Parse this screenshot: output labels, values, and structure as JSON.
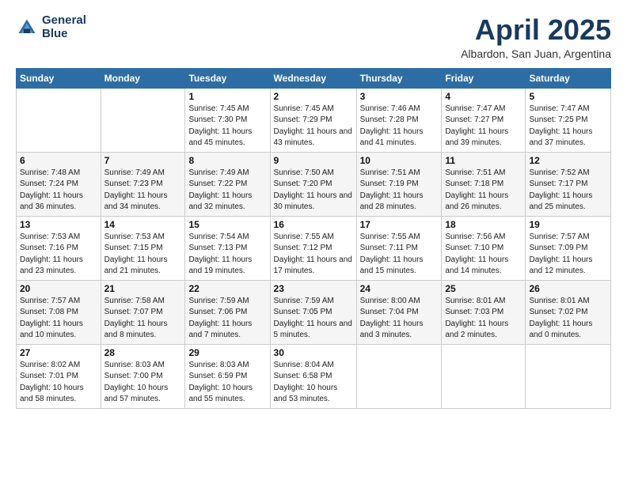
{
  "header": {
    "logo_line1": "General",
    "logo_line2": "Blue",
    "month": "April 2025",
    "location": "Albardon, San Juan, Argentina"
  },
  "days_of_week": [
    "Sunday",
    "Monday",
    "Tuesday",
    "Wednesday",
    "Thursday",
    "Friday",
    "Saturday"
  ],
  "weeks": [
    [
      {
        "day": "",
        "info": ""
      },
      {
        "day": "",
        "info": ""
      },
      {
        "day": "1",
        "info": "Sunrise: 7:45 AM\nSunset: 7:30 PM\nDaylight: 11 hours and 45 minutes."
      },
      {
        "day": "2",
        "info": "Sunrise: 7:45 AM\nSunset: 7:29 PM\nDaylight: 11 hours and 43 minutes."
      },
      {
        "day": "3",
        "info": "Sunrise: 7:46 AM\nSunset: 7:28 PM\nDaylight: 11 hours and 41 minutes."
      },
      {
        "day": "4",
        "info": "Sunrise: 7:47 AM\nSunset: 7:27 PM\nDaylight: 11 hours and 39 minutes."
      },
      {
        "day": "5",
        "info": "Sunrise: 7:47 AM\nSunset: 7:25 PM\nDaylight: 11 hours and 37 minutes."
      }
    ],
    [
      {
        "day": "6",
        "info": "Sunrise: 7:48 AM\nSunset: 7:24 PM\nDaylight: 11 hours and 36 minutes."
      },
      {
        "day": "7",
        "info": "Sunrise: 7:49 AM\nSunset: 7:23 PM\nDaylight: 11 hours and 34 minutes."
      },
      {
        "day": "8",
        "info": "Sunrise: 7:49 AM\nSunset: 7:22 PM\nDaylight: 11 hours and 32 minutes."
      },
      {
        "day": "9",
        "info": "Sunrise: 7:50 AM\nSunset: 7:20 PM\nDaylight: 11 hours and 30 minutes."
      },
      {
        "day": "10",
        "info": "Sunrise: 7:51 AM\nSunset: 7:19 PM\nDaylight: 11 hours and 28 minutes."
      },
      {
        "day": "11",
        "info": "Sunrise: 7:51 AM\nSunset: 7:18 PM\nDaylight: 11 hours and 26 minutes."
      },
      {
        "day": "12",
        "info": "Sunrise: 7:52 AM\nSunset: 7:17 PM\nDaylight: 11 hours and 25 minutes."
      }
    ],
    [
      {
        "day": "13",
        "info": "Sunrise: 7:53 AM\nSunset: 7:16 PM\nDaylight: 11 hours and 23 minutes."
      },
      {
        "day": "14",
        "info": "Sunrise: 7:53 AM\nSunset: 7:15 PM\nDaylight: 11 hours and 21 minutes."
      },
      {
        "day": "15",
        "info": "Sunrise: 7:54 AM\nSunset: 7:13 PM\nDaylight: 11 hours and 19 minutes."
      },
      {
        "day": "16",
        "info": "Sunrise: 7:55 AM\nSunset: 7:12 PM\nDaylight: 11 hours and 17 minutes."
      },
      {
        "day": "17",
        "info": "Sunrise: 7:55 AM\nSunset: 7:11 PM\nDaylight: 11 hours and 15 minutes."
      },
      {
        "day": "18",
        "info": "Sunrise: 7:56 AM\nSunset: 7:10 PM\nDaylight: 11 hours and 14 minutes."
      },
      {
        "day": "19",
        "info": "Sunrise: 7:57 AM\nSunset: 7:09 PM\nDaylight: 11 hours and 12 minutes."
      }
    ],
    [
      {
        "day": "20",
        "info": "Sunrise: 7:57 AM\nSunset: 7:08 PM\nDaylight: 11 hours and 10 minutes."
      },
      {
        "day": "21",
        "info": "Sunrise: 7:58 AM\nSunset: 7:07 PM\nDaylight: 11 hours and 8 minutes."
      },
      {
        "day": "22",
        "info": "Sunrise: 7:59 AM\nSunset: 7:06 PM\nDaylight: 11 hours and 7 minutes."
      },
      {
        "day": "23",
        "info": "Sunrise: 7:59 AM\nSunset: 7:05 PM\nDaylight: 11 hours and 5 minutes."
      },
      {
        "day": "24",
        "info": "Sunrise: 8:00 AM\nSunset: 7:04 PM\nDaylight: 11 hours and 3 minutes."
      },
      {
        "day": "25",
        "info": "Sunrise: 8:01 AM\nSunset: 7:03 PM\nDaylight: 11 hours and 2 minutes."
      },
      {
        "day": "26",
        "info": "Sunrise: 8:01 AM\nSunset: 7:02 PM\nDaylight: 11 hours and 0 minutes."
      }
    ],
    [
      {
        "day": "27",
        "info": "Sunrise: 8:02 AM\nSunset: 7:01 PM\nDaylight: 10 hours and 58 minutes."
      },
      {
        "day": "28",
        "info": "Sunrise: 8:03 AM\nSunset: 7:00 PM\nDaylight: 10 hours and 57 minutes."
      },
      {
        "day": "29",
        "info": "Sunrise: 8:03 AM\nSunset: 6:59 PM\nDaylight: 10 hours and 55 minutes."
      },
      {
        "day": "30",
        "info": "Sunrise: 8:04 AM\nSunset: 6:58 PM\nDaylight: 10 hours and 53 minutes."
      },
      {
        "day": "",
        "info": ""
      },
      {
        "day": "",
        "info": ""
      },
      {
        "day": "",
        "info": ""
      }
    ]
  ]
}
